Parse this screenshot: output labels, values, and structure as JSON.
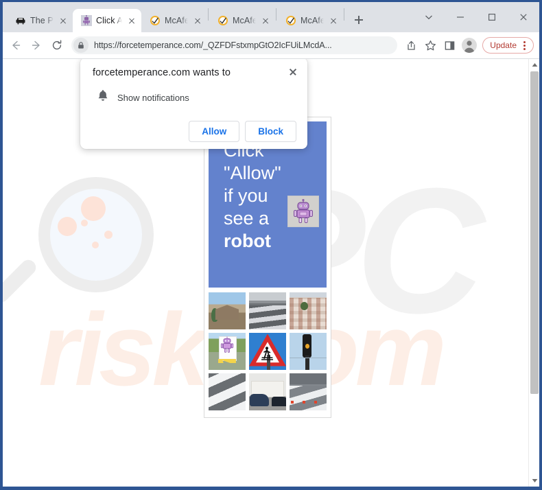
{
  "browser": {
    "tabs": [
      {
        "title": "The Pi",
        "icon": "sofa-icon",
        "active": false
      },
      {
        "title": "Click A",
        "icon": "robot-icon",
        "active": true
      },
      {
        "title": "McAfe",
        "icon": "mcafee-shield-icon",
        "active": false
      },
      {
        "title": "McAfe",
        "icon": "mcafee-shield-icon",
        "active": false
      },
      {
        "title": "McAfe",
        "icon": "mcafee-shield-icon",
        "active": false
      }
    ],
    "new_tab_tooltip": "New tab",
    "window_controls": {
      "tab_search": "tab-search-chevron",
      "minimize": "minimize",
      "maximize": "maximize",
      "close": "close"
    },
    "toolbar": {
      "back": "back-arrow",
      "forward": "forward-arrow",
      "reload": "reload",
      "lock": "site-lock",
      "url": "https://forcetemperance.com/_QZFDFstxmpGtO2IcFUiLMcdA...",
      "share": "share-icon",
      "bookmark": "star-icon",
      "side_panel": "side-panel-icon",
      "profile": "avatar-icon",
      "update_label": "Update",
      "menu": "three-dot-menu"
    }
  },
  "permission_dialog": {
    "title": "forcetemperance.com wants to",
    "permission_icon": "bell-icon",
    "permission_label": "Show notifications",
    "allow_label": "Allow",
    "block_label": "Block",
    "close_label": "Close"
  },
  "page": {
    "banner": {
      "line1": "Click",
      "line2": "\"Allow\"",
      "line3": "if you",
      "line4": "see a",
      "line5": "robot",
      "background_color": "#6382cd",
      "robot_thumb_alt": "robot-thumbnail"
    },
    "captcha_grid": [
      {
        "alt": "houses-with-tree",
        "art": "im-houses"
      },
      {
        "alt": "crosswalk-grayscale",
        "art": "im-crossgray"
      },
      {
        "alt": "aerial-town-view",
        "art": "im-aerial"
      },
      {
        "alt": "robot-poster-sign",
        "art": "im-robotsign"
      },
      {
        "alt": "pedestrian-crossing-sign",
        "art": "im-pedsign"
      },
      {
        "alt": "traffic-light",
        "art": "im-trafficlight"
      },
      {
        "alt": "zebra-crossing-stripes",
        "art": "im-zebra"
      },
      {
        "alt": "car-parked-by-house",
        "art": "im-carhouse"
      },
      {
        "alt": "crosswalk-with-cones",
        "art": "im-crosscone"
      }
    ],
    "watermark": {
      "text_pc": "PC",
      "text_risk": "risk",
      "text_com": "om",
      "glass_alt": "magnifying-glass-watermark"
    }
  },
  "colors": {
    "chrome_tabstrip": "#dee1e6",
    "window_frame": "#2e5593",
    "banner_blue": "#6382cd",
    "link_blue": "#1a73e8",
    "update_red": "#b33b32"
  }
}
